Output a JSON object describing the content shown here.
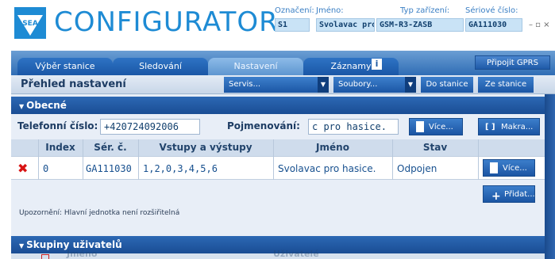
{
  "header": {
    "brand": "CONFIGURATOR",
    "logo_text": "SEA",
    "fields": {
      "oznaceni": {
        "label": "Označení:",
        "value": "S1"
      },
      "jmeno": {
        "label": "Jméno:",
        "value": "Svolavac pro hasice"
      },
      "typ": {
        "label": "Typ zařízení:",
        "value": "GSM-R3-ZASB"
      },
      "seriove": {
        "label": "Sériové číslo:",
        "value": "GA111030"
      }
    },
    "window_controls": "– ▫ ×"
  },
  "tabs": [
    {
      "label": "Výběr stanice"
    },
    {
      "label": "Sledování"
    },
    {
      "label": "Nastavení",
      "active": true
    },
    {
      "label": "Záznamy"
    }
  ],
  "info_label": "i",
  "gprs_button": "Připojit GPRS",
  "toolbar": {
    "title": "Přehled nastavení",
    "servis": "Servis...",
    "soubory": "Soubory...",
    "do_stanice": "Do stanice",
    "ze_stanice": "Ze stanice"
  },
  "obecne": {
    "title": "Obecné",
    "phone_label": "Telefonní číslo:",
    "phone_value": "+420724092006",
    "name_label": "Pojmenování:",
    "name_value": "c pro hasice.",
    "vice": "Více...",
    "makra": "Makra..."
  },
  "table": {
    "headers": [
      "Index",
      "Sér. č.",
      "Vstupy a výstupy",
      "Jméno",
      "Stav"
    ],
    "rows": [
      {
        "index": "0",
        "serial": "GA111030",
        "io": "1,2,0,3,4,5,6",
        "name": "Svolavac pro hasice.",
        "status": "Odpojen",
        "action": "Více..."
      }
    ],
    "add_button": "Přidat...",
    "note": "Upozornění: Hlavní jednotka není rozšiřitelná"
  },
  "skupiny": {
    "title": "Skupiny uživatelů",
    "col_name": "Jméno",
    "col_users": "Uživatelé"
  },
  "colors": {
    "brand_blue": "#1e8bd4",
    "header_bar": "#2c68b4",
    "delete_red": "#d81414"
  }
}
